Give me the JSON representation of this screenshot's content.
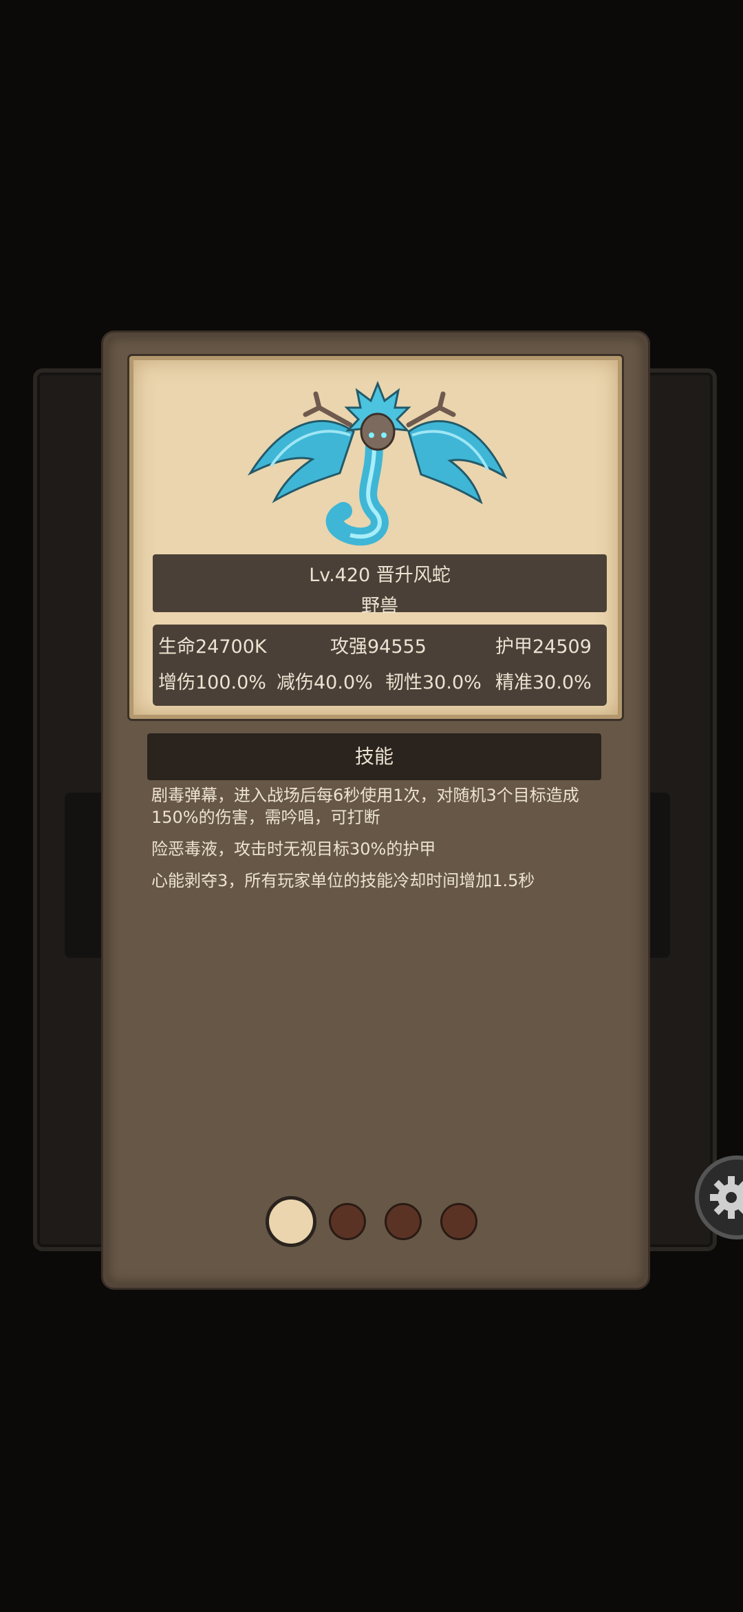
{
  "monster": {
    "name_line": "Lv.420 晋升风蛇",
    "type": "野兽"
  },
  "stats": {
    "hp": "生命24700K",
    "attack": "攻强94555",
    "armor": "护甲24509",
    "damage_increase": "增伤100.0%",
    "damage_reduction": "减伤40.0%",
    "toughness": "韧性30.0%",
    "accuracy": "精准30.0%"
  },
  "skills": {
    "header": "技能",
    "items": [
      "剧毒弹幕，进入战场后每6秒使用1次，对随机3个目标造成150%的伤害，需吟唱，可打断",
      "险恶毒液，攻击时无视目标30%的护甲",
      "心能剥夺3，所有玩家单位的技能冷却时间增加1.5秒"
    ]
  },
  "pager": {
    "total": 4,
    "active": 0
  },
  "icons": {
    "creature": "wind-serpent-portrait",
    "settings": "gear-icon"
  }
}
